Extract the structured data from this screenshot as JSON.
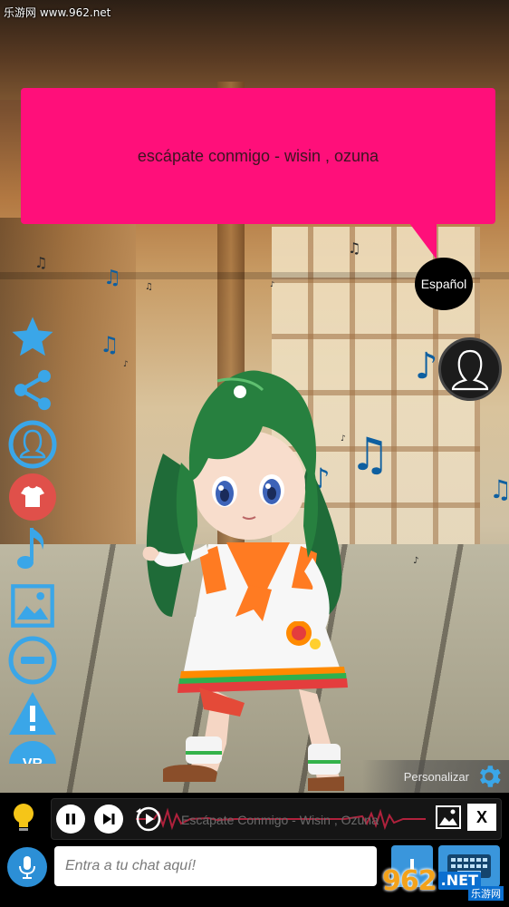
{
  "watermark": {
    "top_text": "乐游网 www.962.net",
    "bottom_logo": "962",
    "bottom_net": ".NET",
    "bottom_cn": "乐游网"
  },
  "speech": {
    "text": "escápate conmigo - wisin , ozuna"
  },
  "language_button": {
    "label": "Español"
  },
  "toolbar": {
    "items": [
      {
        "icon": "star-icon"
      },
      {
        "icon": "share-icon"
      },
      {
        "icon": "avatar-outline-icon"
      },
      {
        "icon": "shirt-icon"
      },
      {
        "icon": "music-note-icon"
      },
      {
        "icon": "image-icon"
      },
      {
        "icon": "minus-circle-icon"
      },
      {
        "icon": "warning-icon"
      },
      {
        "icon": "vr-icon",
        "label": "VR"
      }
    ]
  },
  "customize": {
    "label": "Personalizar",
    "icon": "gear-icon"
  },
  "player": {
    "track_title": "Escápate Conmigo - Wisin , Ozuna",
    "close_label": "X"
  },
  "chat": {
    "placeholder": "Entra a tu chat aquí!"
  },
  "colors": {
    "bubble": "#ff0f7a",
    "accent_blue": "#2c8fd6",
    "toolbar_blue": "#3aa6e8",
    "shirt_red": "#e0504a"
  }
}
